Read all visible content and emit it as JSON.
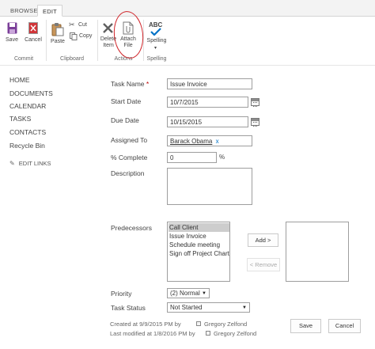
{
  "ribbon": {
    "tabs": [
      {
        "label": "BROWSE",
        "active": false
      },
      {
        "label": "EDIT",
        "active": true
      }
    ],
    "buttons": {
      "save": "Save",
      "cancel": "Cancel",
      "paste": "Paste",
      "cut": "Cut",
      "copy": "Copy",
      "delete_line1": "Delete",
      "delete_line2": "Item",
      "attach_line1": "Attach",
      "attach_line2": "File",
      "spelling": "Spelling",
      "spelling_glyph": "ABC"
    },
    "groups": {
      "commit": "Commit",
      "clipboard": "Clipboard",
      "actions": "Actions",
      "spelling": "Spelling"
    }
  },
  "nav": {
    "items": [
      "HOME",
      "DOCUMENTS",
      "CALENDAR",
      "TASKS",
      "CONTACTS",
      "Recycle Bin"
    ],
    "edit_links": "EDIT LINKS"
  },
  "form": {
    "task_name": {
      "label": "Task Name",
      "required_mark": "*",
      "value": "Issue Invoice"
    },
    "start_date": {
      "label": "Start Date",
      "value": "10/7/2015"
    },
    "due_date": {
      "label": "Due Date",
      "value": "10/15/2015"
    },
    "assigned_to": {
      "label": "Assigned To",
      "value": "Barack Obama",
      "remove": "x"
    },
    "percent_complete": {
      "label": "% Complete",
      "value": "0",
      "suffix": "%"
    },
    "description": {
      "label": "Description",
      "value": ""
    },
    "predecessors": {
      "label": "Predecessors",
      "available": [
        "Call Client",
        "Issue Invoice",
        "Schedule meeting",
        "Sign off Project Chart"
      ],
      "selected_index": 0,
      "add_button": "Add >",
      "remove_button": "< Remove"
    },
    "priority": {
      "label": "Priority",
      "value": "(2) Normal"
    },
    "task_status": {
      "label": "Task Status",
      "value": "Not Started"
    }
  },
  "footer": {
    "created": "Created at 9/9/2015 PM",
    "modified": "Last modified at 1/8/2016 PM",
    "by": "by",
    "created_by": "Gregory Zelfond",
    "modified_by": "Gregory Zelfond",
    "save": "Save",
    "cancel": "Cancel"
  },
  "colors": {
    "accent_blue": "#0072c6",
    "save_icon": "#7b3f99",
    "cancel_icon": "#d13438",
    "annotation": "#d0252a"
  }
}
